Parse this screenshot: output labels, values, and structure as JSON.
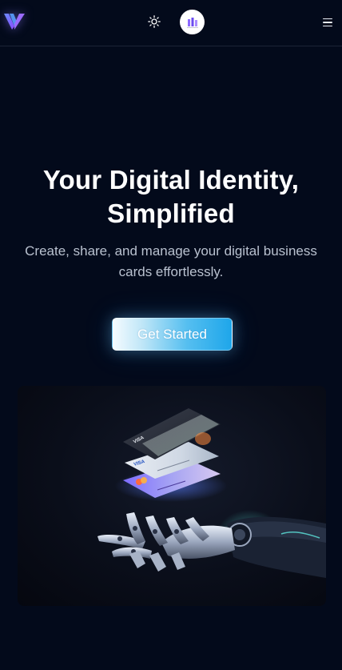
{
  "header": {
    "logo_icon": "v-brand-logo",
    "theme_toggle_icon": "sun-icon",
    "avatar_icon": "brand-avatar",
    "menu_icon": "hamburger-menu-icon"
  },
  "hero": {
    "title_line1": "Your Digital Identity,",
    "title_line2": "Simplified",
    "subtitle": "Create, share, and manage your digital business cards effortlessly.",
    "cta_label": "Get Started"
  },
  "showcase": {
    "card_top_brand": "VISA",
    "card_middle_brand": "VISA"
  },
  "colors": {
    "background": "#030a1b",
    "accent_cyan": "#1ea6ea",
    "logo_purple": "#7c5cff",
    "text_muted": "#b9c1cf"
  }
}
